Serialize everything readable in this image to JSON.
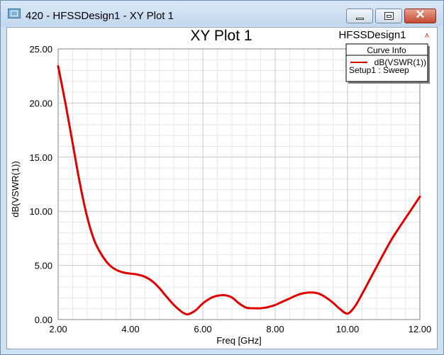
{
  "window": {
    "title": "420 - HFSSDesign1 - XY Plot 1",
    "close_glyph": "✕"
  },
  "plot": {
    "design_name": "HFSSDesign1",
    "logo_glyph": "⩚",
    "legend": {
      "title": "Curve Info",
      "entries": [
        {
          "label": "dB(VSWR(1))",
          "sublabel": "Setup1 : Sweep",
          "color": "#e00000"
        }
      ]
    }
  },
  "colors": {
    "trace": "#e00000",
    "major_grid": "#c8c8c8",
    "minor_grid": "#e6e6e6",
    "logo": "#d9534f"
  },
  "chart_data": {
    "type": "line",
    "title": "XY Plot 1",
    "xlabel": "Freq [GHz]",
    "ylabel": "dB(VSWR(1))",
    "xlim": [
      2.0,
      12.0
    ],
    "ylim": [
      0.0,
      25.0
    ],
    "x_ticks": [
      "2.00",
      "4.00",
      "6.00",
      "8.00",
      "10.00",
      "12.00"
    ],
    "y_ticks": [
      "0.00",
      "5.00",
      "10.00",
      "15.00",
      "20.00",
      "25.00"
    ],
    "grid": true,
    "legend_position": "top-right",
    "series": [
      {
        "name": "dB(VSWR(1))",
        "x": [
          2.0,
          2.2,
          2.4,
          2.6,
          2.8,
          3.0,
          3.2,
          3.4,
          3.6,
          3.8,
          4.0,
          4.2,
          4.4,
          4.6,
          4.8,
          5.0,
          5.2,
          5.4,
          5.5,
          5.6,
          5.8,
          6.0,
          6.2,
          6.4,
          6.6,
          6.8,
          7.0,
          7.2,
          7.4,
          7.6,
          7.8,
          8.0,
          8.2,
          8.4,
          8.6,
          8.8,
          9.0,
          9.2,
          9.4,
          9.6,
          9.8,
          10.0,
          10.2,
          10.4,
          10.6,
          10.8,
          11.0,
          11.2,
          11.4,
          11.6,
          11.8,
          12.0
        ],
        "y": [
          23.4,
          20.0,
          16.3,
          12.6,
          9.5,
          7.3,
          6.0,
          5.1,
          4.6,
          4.35,
          4.25,
          4.15,
          3.95,
          3.55,
          2.9,
          2.1,
          1.35,
          0.75,
          0.55,
          0.5,
          0.85,
          1.5,
          1.95,
          2.2,
          2.25,
          2.05,
          1.5,
          1.1,
          1.05,
          1.05,
          1.15,
          1.35,
          1.65,
          1.95,
          2.25,
          2.45,
          2.5,
          2.4,
          2.05,
          1.55,
          0.95,
          0.55,
          1.2,
          2.35,
          3.6,
          4.85,
          6.1,
          7.3,
          8.35,
          9.35,
          10.35,
          11.35
        ]
      }
    ]
  }
}
